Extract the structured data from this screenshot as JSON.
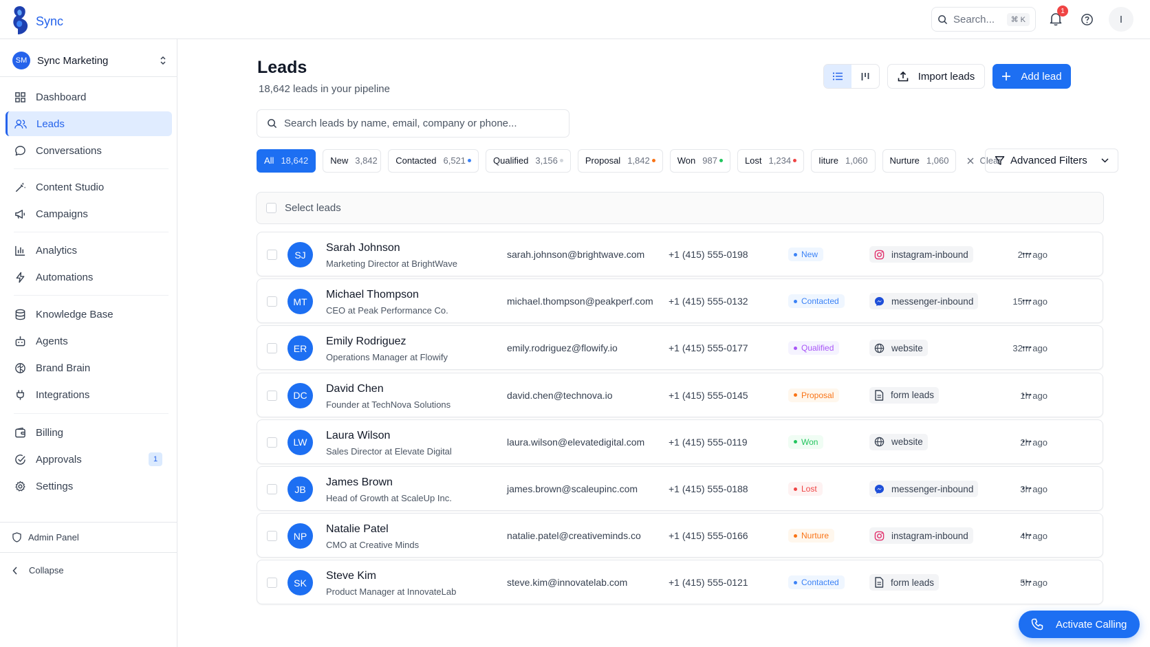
{
  "app": {
    "name": "Sync"
  },
  "topbar": {
    "search_placeholder": "Search...",
    "search_shortcut": "⌘ K",
    "notif_count": "1",
    "user_initial": "I"
  },
  "workspace": {
    "initials": "SM",
    "name": "Sync Marketing"
  },
  "nav": [
    {
      "label": "Dashboard",
      "icon": "grid-icon"
    },
    {
      "label": "Leads",
      "icon": "users-icon",
      "active": true
    },
    {
      "label": "Conversations",
      "icon": "chat-icon"
    },
    {
      "label": "Content Studio",
      "icon": "wand-icon"
    },
    {
      "label": "Campaigns",
      "icon": "megaphone-icon"
    },
    {
      "label": "Analytics",
      "icon": "bar-chart-icon"
    },
    {
      "label": "Automations",
      "icon": "lightning-icon"
    },
    {
      "label": "Knowledge Base",
      "icon": "database-icon"
    },
    {
      "label": "Agents",
      "icon": "bot-icon"
    },
    {
      "label": "Brand Brain",
      "icon": "brain-icon"
    },
    {
      "label": "Integrations",
      "icon": "plug-icon"
    },
    {
      "label": "Billing",
      "icon": "wallet-icon"
    },
    {
      "label": "Approvals",
      "icon": "check-circle-icon",
      "badge": "1"
    },
    {
      "label": "Settings",
      "icon": "gear-icon"
    }
  ],
  "sidebar_footer": {
    "admin": "Admin Panel",
    "collapse": "Collapse"
  },
  "header": {
    "title": "Leads",
    "subtitle": "18,642 leads in your pipeline",
    "import_label": "Import leads",
    "add_label": "Add lead"
  },
  "lead_search": {
    "placeholder": "Search leads by name, email, company or phone..."
  },
  "filters": [
    {
      "label": "All",
      "count": "18,642",
      "active": true
    },
    {
      "label": "New",
      "count": "3,842"
    },
    {
      "label": "Contacted",
      "count": "6,521",
      "dot": "#3b82f6"
    },
    {
      "label": "Qualified",
      "count": "3,156",
      "dot": "#d1d5db"
    },
    {
      "label": "Proposal",
      "count": "1,842",
      "dot": "#f97316"
    },
    {
      "label": "Won",
      "count": "987",
      "dot": "#22c55e"
    },
    {
      "label": "Lost",
      "count": "1,234",
      "dot": "#ef4444"
    },
    {
      "label": "Iiture",
      "count": "1,060"
    },
    {
      "label": "Nurture",
      "count": "1,060"
    }
  ],
  "filters_clear": "Clear",
  "advanced_filters": "Advanced Filters",
  "select_leads": "Select leads",
  "leads": [
    {
      "initials": "SJ",
      "name": "Sarah Johnson",
      "title": "Marketing Director at BrightWave",
      "email": "sarah.johnson@brightwave.com",
      "phone": "+1 (415) 555-0198",
      "status": "New",
      "source": "instagram-inbound",
      "source_icon": "instagram-icon",
      "time": "2m ago"
    },
    {
      "initials": "MT",
      "name": "Michael Thompson",
      "title": "CEO at Peak Performance Co.",
      "email": "michael.thompson@peakperf.com",
      "phone": "+1 (415) 555-0132",
      "status": "Contacted",
      "source": "messenger-inbound",
      "source_icon": "messenger-icon",
      "time": "15m ago"
    },
    {
      "initials": "ER",
      "name": "Emily Rodriguez",
      "title": "Operations Manager at Flowify",
      "email": "emily.rodriguez@flowify.io",
      "phone": "+1 (415) 555-0177",
      "status": "Qualified",
      "source": "website",
      "source_icon": "globe-icon",
      "time": "32m ago"
    },
    {
      "initials": "DC",
      "name": "David Chen",
      "title": "Founder at TechNova Solutions",
      "email": "david.chen@technova.io",
      "phone": "+1 (415) 555-0145",
      "status": "Proposal",
      "source": "form leads",
      "source_icon": "document-icon",
      "time": "1h ago"
    },
    {
      "initials": "LW",
      "name": "Laura Wilson",
      "title": "Sales Director at Elevate Digital",
      "email": "laura.wilson@elevatedigital.com",
      "phone": "+1 (415) 555-0119",
      "status": "Won",
      "source": "website",
      "source_icon": "globe-icon",
      "time": "2h ago"
    },
    {
      "initials": "JB",
      "name": "James Brown",
      "title": "Head of Growth at ScaleUp Inc.",
      "email": "james.brown@scaleupinc.com",
      "phone": "+1 (415) 555-0188",
      "status": "Lost",
      "source": "messenger-inbound",
      "source_icon": "messenger-icon",
      "time": "3h ago"
    },
    {
      "initials": "NP",
      "name": "Natalie Patel",
      "title": "CMO at Creative Minds",
      "email": "natalie.patel@creativeminds.co",
      "phone": "+1 (415) 555-0166",
      "status": "Nurture",
      "source": "instagram-inbound",
      "source_icon": "instagram-icon",
      "time": "4h ago"
    },
    {
      "initials": "SK",
      "name": "Steve Kim",
      "title": "Product Manager at InnovateLab",
      "email": "steve.kim@innovatelab.com",
      "phone": "+1 (415) 555-0121",
      "status": "Contacted",
      "source": "form leads",
      "source_icon": "document-icon",
      "time": "5h ago"
    }
  ],
  "status_colors": {
    "New": {
      "bg": "#eff6ff",
      "fg": "#3b82f6"
    },
    "Contacted": {
      "bg": "#eff6ff",
      "fg": "#3b82f6"
    },
    "Qualified": {
      "bg": "#f5f3ff",
      "fg": "#a855f7"
    },
    "Proposal": {
      "bg": "#fff7ed",
      "fg": "#f97316"
    },
    "Won": {
      "bg": "#f0fdf4",
      "fg": "#22c55e"
    },
    "Lost": {
      "bg": "#fef2f2",
      "fg": "#ef4444"
    },
    "Nurture": {
      "bg": "#fff7ed",
      "fg": "#f97316"
    }
  },
  "fab": {
    "label": "Activate Calling"
  },
  "colors": {
    "accent": "#1d6ff2"
  }
}
